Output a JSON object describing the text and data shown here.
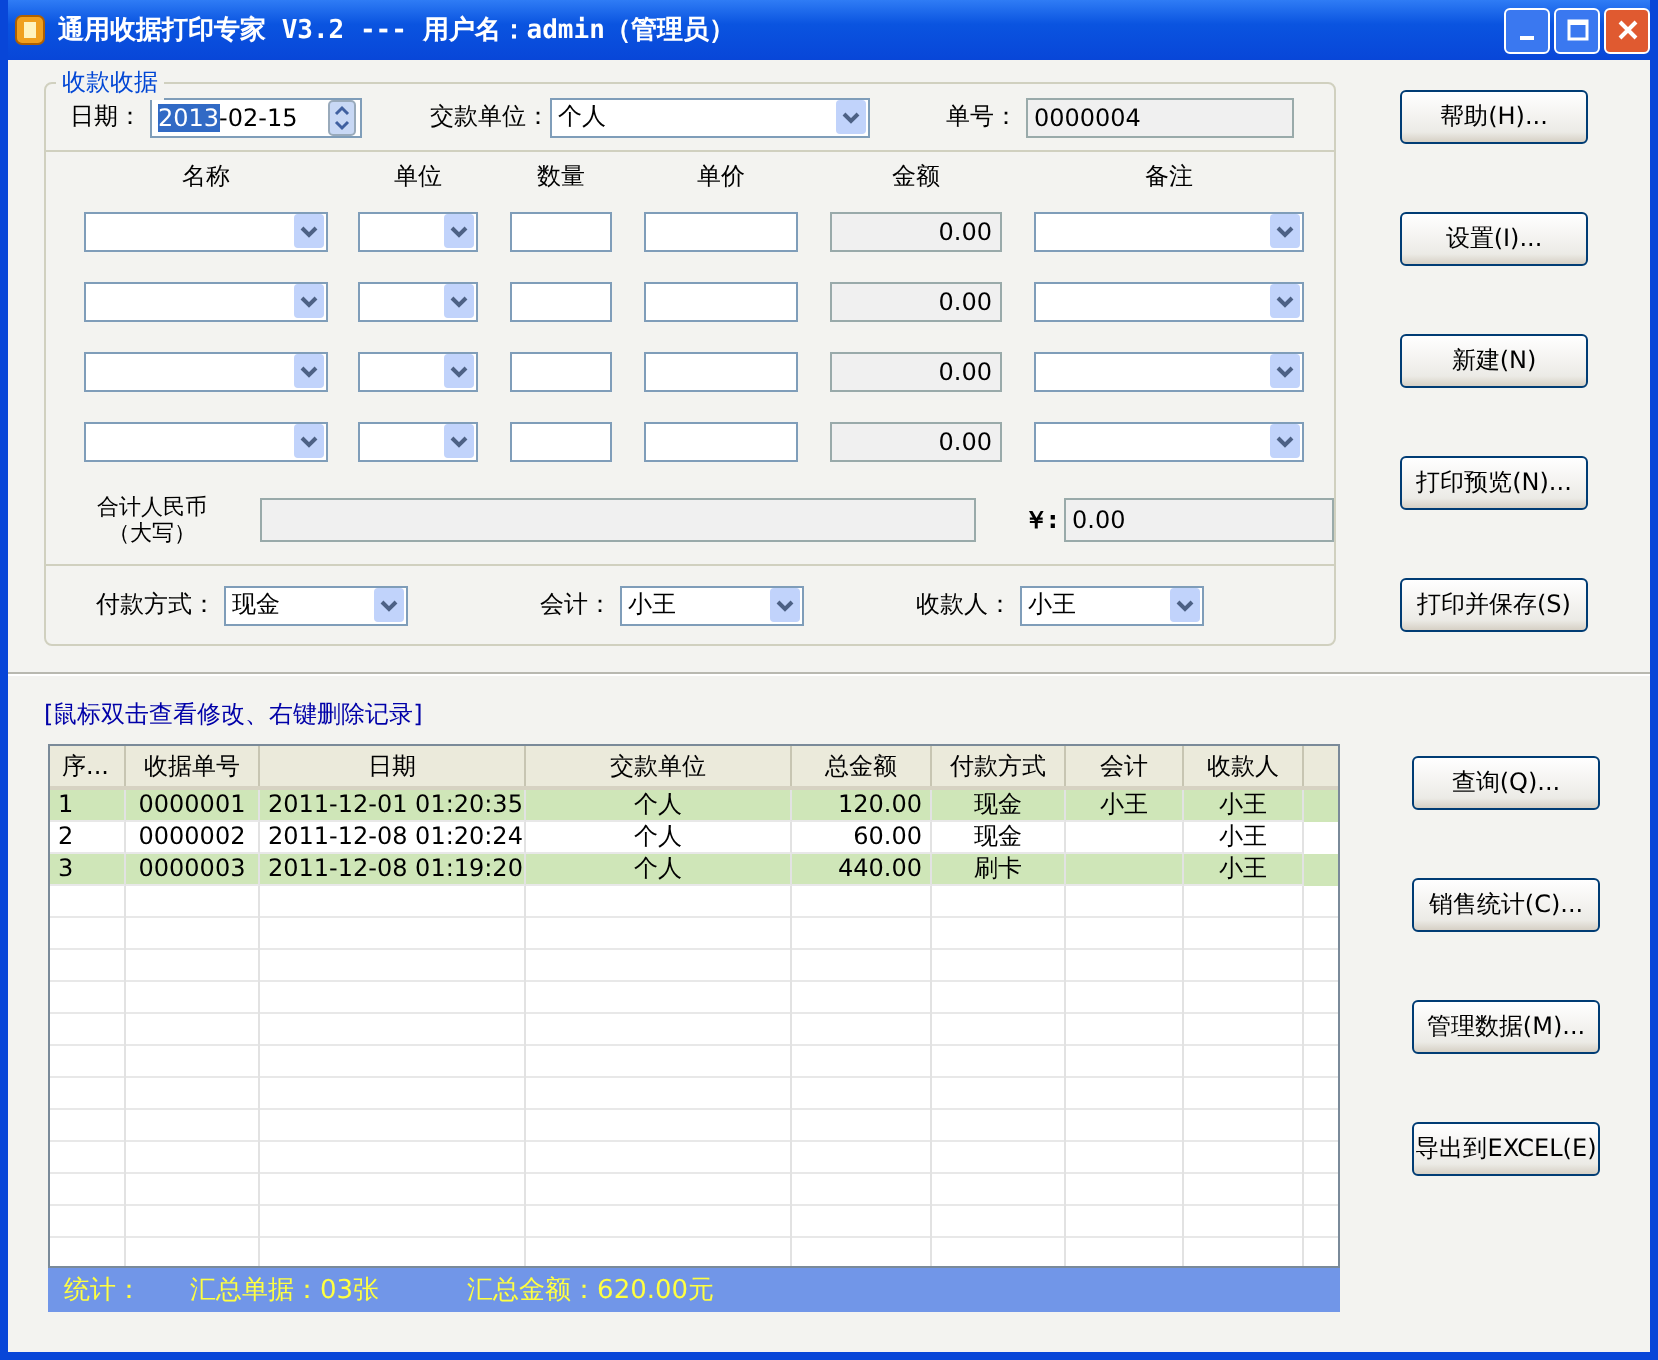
{
  "window": {
    "title": "通用收据打印专家 V3.2 --- 用户名：admin（管理员）"
  },
  "receipt": {
    "legend": "收款收据",
    "date": {
      "label": "日期：",
      "highlighted": "2013",
      "rest": "-02-15"
    },
    "payer": {
      "label": "交款单位：",
      "value": "个人"
    },
    "number": {
      "label": "单号：",
      "value": "0000004"
    },
    "columns": [
      "名称",
      "单位",
      "数量",
      "单价",
      "金额",
      "备注"
    ],
    "items": [
      {
        "amount": "0.00"
      },
      {
        "amount": "0.00"
      },
      {
        "amount": "0.00"
      },
      {
        "amount": "0.00"
      }
    ],
    "total": {
      "label": "合计人民币",
      "sub": "（大写）",
      "currency": "￥:",
      "value": "0.00"
    },
    "payment": {
      "label": "付款方式：",
      "value": "现金"
    },
    "accountant": {
      "label": "会计：",
      "value": "小王"
    },
    "cashier": {
      "label": "收款人：",
      "value": "小王"
    }
  },
  "side_buttons": [
    "帮助(H)...",
    "设置(I)...",
    "新建(N)",
    "打印预览(N)...",
    "打印并保存(S)"
  ],
  "hint": "[鼠标双击查看修改、右键删除记录]",
  "table": {
    "columns": [
      "序...",
      "收据单号",
      "日期",
      "交款单位",
      "总金额",
      "付款方式",
      "会计",
      "收款人"
    ],
    "rows": [
      [
        "1",
        "0000001",
        "2011-12-01 01:20:35",
        "个人",
        "120.00",
        "现金",
        "小王",
        "小王"
      ],
      [
        "2",
        "0000002",
        "2011-12-08 01:20:24",
        "个人",
        "60.00",
        "现金",
        "",
        "小王"
      ],
      [
        "3",
        "0000003",
        "2011-12-08 01:19:20",
        "个人",
        "440.00",
        "刷卡",
        "",
        "小王"
      ]
    ]
  },
  "status_bar": {
    "label": "统计：",
    "count": "汇总单据：03张",
    "sum": "汇总金额：620.00元"
  },
  "list_buttons": [
    "查询(Q)...",
    "销售统计(C)...",
    "管理数据(M)...",
    "导出到EXCEL(E)"
  ]
}
